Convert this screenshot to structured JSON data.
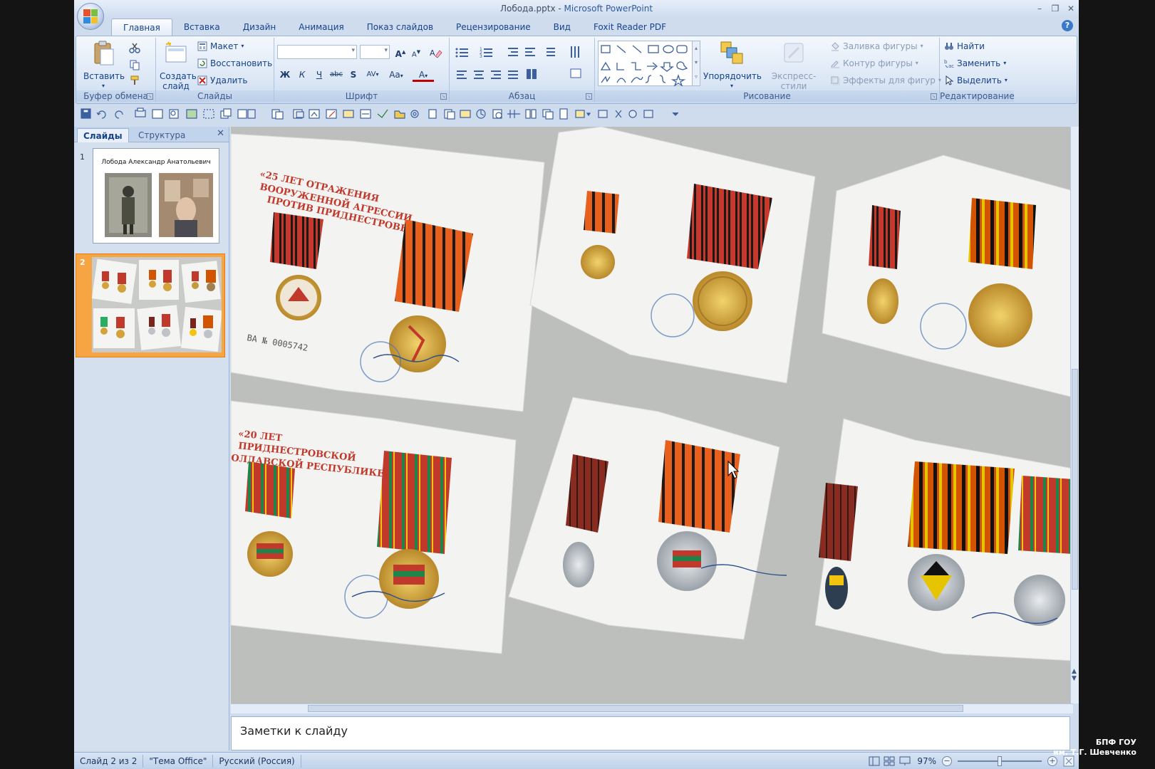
{
  "window": {
    "filename": "Лобода.pptx",
    "separator": " - ",
    "app_name": "Microsoft PowerPoint",
    "controls": [
      "–",
      "❐",
      "✕"
    ]
  },
  "tabs": [
    {
      "label": "Главная",
      "active": true
    },
    {
      "label": "Вставка"
    },
    {
      "label": "Дизайн"
    },
    {
      "label": "Анимация"
    },
    {
      "label": "Показ слайдов"
    },
    {
      "label": "Рецензирование"
    },
    {
      "label": "Вид"
    },
    {
      "label": "Foxit Reader PDF"
    }
  ],
  "help_label": "?",
  "ribbon": {
    "clipboard": {
      "label": "Буфер обмена",
      "paste": "Вставить"
    },
    "slides": {
      "label": "Слайды",
      "new_slide": "Создать слайд",
      "layout": "Макет",
      "reset": "Восстановить",
      "delete": "Удалить"
    },
    "font": {
      "label": "Шрифт",
      "bold": "Ж",
      "italic": "К",
      "underline": "Ч",
      "strike": "abc",
      "shadow": "S",
      "spacing": "AV",
      "case": "Aa",
      "color": "A",
      "grow": "A",
      "shrink": "A"
    },
    "paragraph": {
      "label": "Абзац"
    },
    "drawing": {
      "label": "Рисование",
      "arrange": "Упорядочить",
      "quick_styles": "Экспресс-стили",
      "fill": "Заливка фигуры",
      "outline": "Контур фигуры",
      "effects": "Эффекты для фигур"
    },
    "editing": {
      "label": "Редактирование",
      "find": "Найти",
      "replace": "Заменить",
      "select": "Выделить"
    }
  },
  "slide_panel": {
    "tabs": [
      {
        "label": "Слайды",
        "active": true
      },
      {
        "label": "Структура"
      }
    ],
    "close": "✕",
    "slides": [
      {
        "number": "1",
        "title": "Лобода Александр Анатольевич"
      },
      {
        "number": "2",
        "selected": true
      }
    ]
  },
  "notes": {
    "placeholder": "Заметки к слайду"
  },
  "status": {
    "slide_info": "Слайд 2 из 2",
    "theme": "\"Тема Office\"",
    "language": "Русский (Россия)",
    "zoom": "97%",
    "zoom_fraction": 0.5
  },
  "watermark": {
    "line1": "БПФ ГОУ",
    "line2": "им. Т.Г. Шевченко"
  },
  "colors": {
    "accent": "#15428b",
    "selected_thumb": "#f7a442",
    "ribbon_border": "#9ab3d6"
  }
}
